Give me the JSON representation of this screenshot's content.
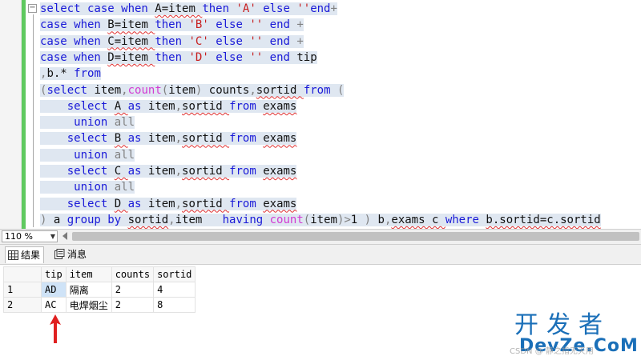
{
  "editor": {
    "lines": [
      {
        "tokens": [
          [
            "kw",
            "select case when "
          ],
          [
            "id",
            "A=item "
          ],
          [
            "kw",
            "then "
          ],
          [
            "str",
            "'A' "
          ],
          [
            "kw",
            "else "
          ],
          [
            "str",
            "''"
          ],
          [
            "kw",
            "end"
          ],
          [
            "op",
            "+"
          ]
        ]
      },
      {
        "tokens": [
          [
            "kw",
            "case when "
          ],
          [
            "id",
            "B=item "
          ],
          [
            "kw",
            "then "
          ],
          [
            "str",
            "'B' "
          ],
          [
            "kw",
            "else "
          ],
          [
            "str",
            "'' "
          ],
          [
            "kw",
            "end "
          ],
          [
            "op",
            "+"
          ]
        ]
      },
      {
        "tokens": [
          [
            "kw",
            "case when "
          ],
          [
            "id",
            "C=item "
          ],
          [
            "kw",
            "then "
          ],
          [
            "str",
            "'C' "
          ],
          [
            "kw",
            "else "
          ],
          [
            "str",
            "'' "
          ],
          [
            "kw",
            "end "
          ],
          [
            "op",
            "+"
          ]
        ]
      },
      {
        "tokens": [
          [
            "kw",
            "case when "
          ],
          [
            "id",
            "D=item "
          ],
          [
            "kw",
            "then "
          ],
          [
            "str",
            "'D' "
          ],
          [
            "kw",
            "else "
          ],
          [
            "str",
            "'' "
          ],
          [
            "kw",
            "end "
          ],
          [
            "id",
            "tip"
          ]
        ]
      },
      {
        "tokens": [
          [
            "op",
            ","
          ],
          [
            "id",
            "b.* "
          ],
          [
            "kw",
            "from"
          ]
        ]
      },
      {
        "tokens": [
          [
            "op",
            "("
          ],
          [
            "kw",
            "select "
          ],
          [
            "id",
            "item"
          ],
          [
            "op",
            ","
          ],
          [
            "fn",
            "count"
          ],
          [
            "op",
            "("
          ],
          [
            "id",
            "item"
          ],
          [
            "op",
            ") "
          ],
          [
            "id",
            "counts"
          ],
          [
            "op",
            ","
          ],
          [
            "id",
            "sortid "
          ],
          [
            "kw",
            "from "
          ],
          [
            "op",
            "("
          ]
        ]
      },
      {
        "tokens": [
          [
            "id",
            "    "
          ],
          [
            "kw",
            "select "
          ],
          [
            "id",
            "A "
          ],
          [
            "kw",
            "as "
          ],
          [
            "id",
            "item"
          ],
          [
            "op",
            ","
          ],
          [
            "id",
            "sortid "
          ],
          [
            "kw",
            "from "
          ],
          [
            "id",
            "exams"
          ]
        ]
      },
      {
        "tokens": [
          [
            "id",
            "     "
          ],
          [
            "kw",
            "union "
          ],
          [
            "op",
            "all"
          ]
        ]
      },
      {
        "tokens": [
          [
            "id",
            "    "
          ],
          [
            "kw",
            "select "
          ],
          [
            "id",
            "B "
          ],
          [
            "kw",
            "as "
          ],
          [
            "id",
            "item"
          ],
          [
            "op",
            ","
          ],
          [
            "id",
            "sortid "
          ],
          [
            "kw",
            "from "
          ],
          [
            "id",
            "exams"
          ]
        ]
      },
      {
        "tokens": [
          [
            "id",
            "     "
          ],
          [
            "kw",
            "union "
          ],
          [
            "op",
            "all"
          ]
        ]
      },
      {
        "tokens": [
          [
            "id",
            "    "
          ],
          [
            "kw",
            "select "
          ],
          [
            "id",
            "C "
          ],
          [
            "kw",
            "as "
          ],
          [
            "id",
            "item"
          ],
          [
            "op",
            ","
          ],
          [
            "id",
            "sortid "
          ],
          [
            "kw",
            "from "
          ],
          [
            "id",
            "exams"
          ]
        ]
      },
      {
        "tokens": [
          [
            "id",
            "     "
          ],
          [
            "kw",
            "union "
          ],
          [
            "op",
            "all"
          ]
        ]
      },
      {
        "tokens": [
          [
            "id",
            "    "
          ],
          [
            "kw",
            "select "
          ],
          [
            "id",
            "D "
          ],
          [
            "kw",
            "as "
          ],
          [
            "id",
            "item"
          ],
          [
            "op",
            ","
          ],
          [
            "id",
            "sortid "
          ],
          [
            "kw",
            "from "
          ],
          [
            "id",
            "exams"
          ]
        ]
      },
      {
        "tokens": [
          [
            "op",
            ") "
          ],
          [
            "id",
            "a "
          ],
          [
            "kw",
            "group by "
          ],
          [
            "id",
            "sortid"
          ],
          [
            "op",
            ","
          ],
          [
            "id",
            "item   "
          ],
          [
            "kw",
            "having "
          ],
          [
            "fn",
            "count"
          ],
          [
            "op",
            "("
          ],
          [
            "id",
            "item"
          ],
          [
            "op",
            ")>"
          ],
          [
            "id",
            "1 "
          ],
          [
            "op",
            ") "
          ],
          [
            "id",
            "b"
          ],
          [
            "op",
            ","
          ],
          [
            "id",
            "exams c "
          ],
          [
            "kw",
            "where "
          ],
          [
            "id",
            "b.sortid=c.sortid"
          ]
        ]
      }
    ],
    "fold_symbol": "−"
  },
  "zoom": {
    "value": "110 %",
    "arrow": "▼"
  },
  "tabs": {
    "results_label": "结果",
    "messages_label": "消息"
  },
  "grid": {
    "columns": [
      "tip",
      "item",
      "counts",
      "sortid"
    ],
    "rows": [
      {
        "num": "1",
        "tip": "AD",
        "item": "隔离",
        "counts": "2",
        "sortid": "4"
      },
      {
        "num": "2",
        "tip": "AC",
        "item": "电焊烟尘",
        "counts": "2",
        "sortid": "8"
      }
    ]
  },
  "watermark": {
    "main": "开发者",
    "site": "DevZe.CoM",
    "small": "CSDN @ 静之指无天用"
  },
  "colors": {
    "keyword": "#1a1ad8",
    "string": "#c81e1e",
    "function": "#d33bd3",
    "gray": "#808080",
    "change_bar": "#5fc95f",
    "arrow": "#e02020",
    "watermark": "#1a6fb8"
  }
}
